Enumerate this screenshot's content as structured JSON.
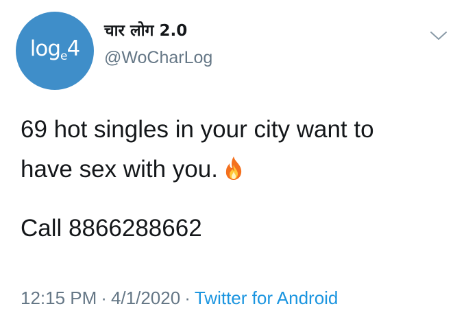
{
  "header": {
    "avatar_text": "log",
    "avatar_sub": "e",
    "avatar_tail": "4",
    "display_name": "चार लोग 2.0",
    "handle": "@WoCharLog",
    "menu_icon": "chevron-down-icon"
  },
  "tweet": {
    "line1": "69 hot singles in your city want to",
    "line2": "have sex with you.",
    "emoji_icon": "fire-icon",
    "line3": "Call 8866288662"
  },
  "meta": {
    "time": "12:15 PM",
    "separator1": "·",
    "date": "4/1/2020",
    "separator2": "·",
    "source": "Twitter for Android"
  },
  "colors": {
    "avatar_bg": "#3f8ec9",
    "text": "#14171a",
    "secondary": "#657786",
    "link": "#1b95e0"
  }
}
